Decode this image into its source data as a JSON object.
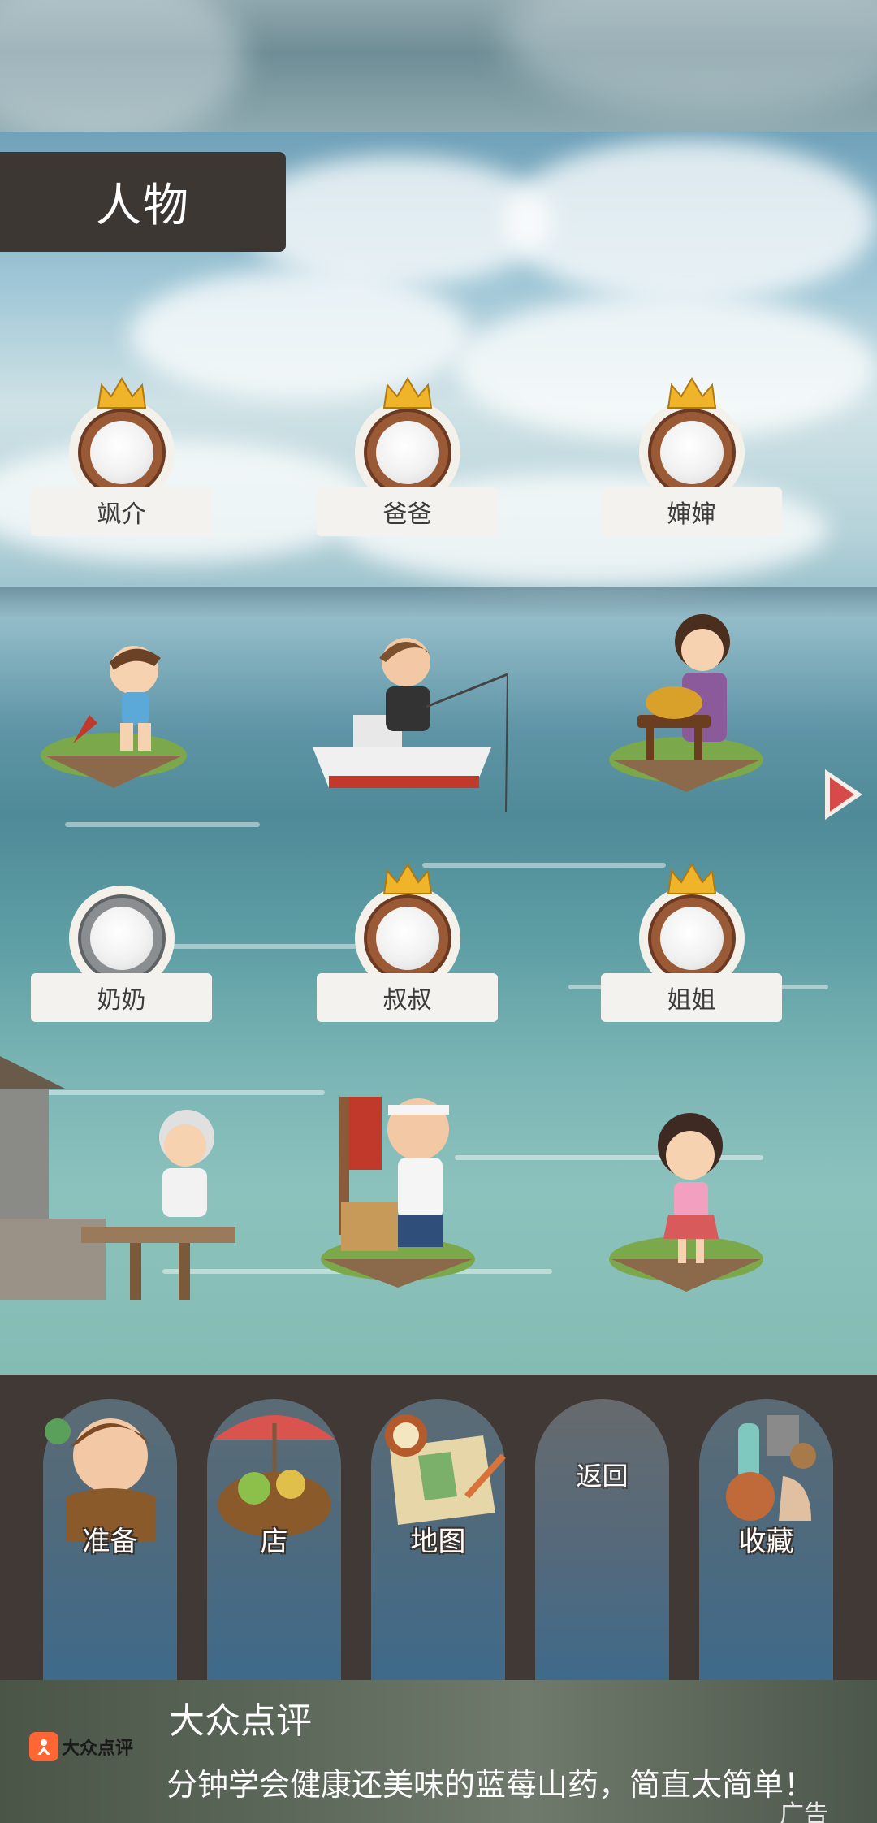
{
  "screen_title": "人物",
  "characters": [
    {
      "name": "飒介",
      "crown": true,
      "medal": "bronze"
    },
    {
      "name": "爸爸",
      "crown": true,
      "medal": "bronze"
    },
    {
      "name": "婶婶",
      "crown": true,
      "medal": "bronze"
    },
    {
      "name": "奶奶",
      "crown": false,
      "medal": "silver"
    },
    {
      "name": "叔叔",
      "crown": true,
      "medal": "bronze"
    },
    {
      "name": "姐姐",
      "crown": true,
      "medal": "bronze"
    }
  ],
  "next_page_icon": "triangle-right-icon",
  "menu": [
    {
      "label": "准备",
      "icon": "boy-character-icon"
    },
    {
      "label": "店",
      "icon": "market-stall-icon"
    },
    {
      "label": "地图",
      "icon": "map-compass-icon"
    },
    {
      "label": "返回",
      "icon": ""
    },
    {
      "label": "收藏",
      "icon": "treasure-pile-icon"
    }
  ],
  "ad": {
    "brand": "大众点评",
    "title": "大众点评",
    "description": "分钟学会健康还美味的蓝莓山药，简直太简单！",
    "mark": "广告"
  },
  "colors": {
    "title_bg": "#3d3734",
    "menu_bg": "#403936",
    "arrow": "#d64a4a",
    "brand_orange": "#ff6633"
  }
}
